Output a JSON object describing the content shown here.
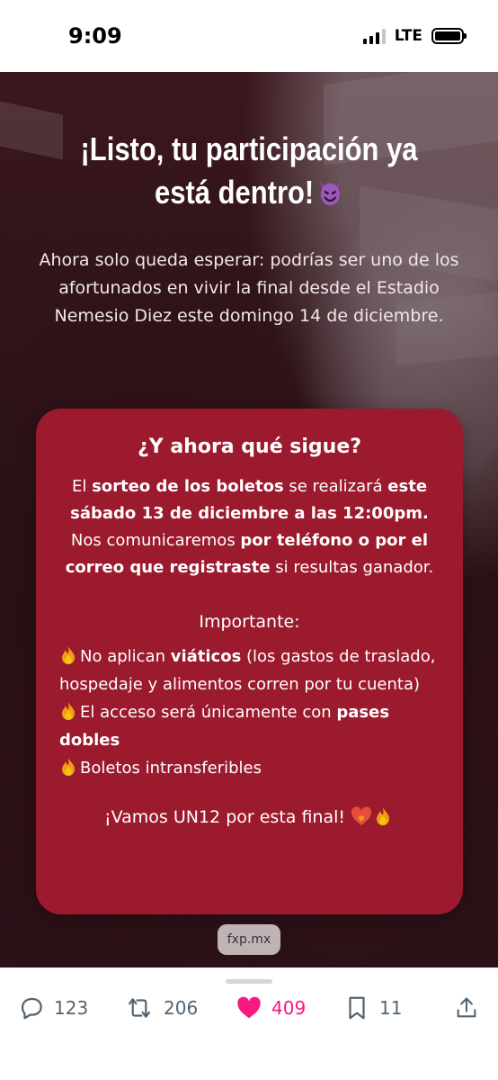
{
  "status_bar": {
    "time": "9:09",
    "network": "LTE"
  },
  "post": {
    "headline_line1": "¡Listo, tu participación ya",
    "headline_line2": "está dentro!",
    "subtext": "Ahora solo queda esperar: podrías ser uno de los afortunados en vivir la final desde el Estadio Nemesio Diez este domingo 14 de diciembre.",
    "card": {
      "title": "¿Y ahora qué sigue?",
      "p1_a": "El ",
      "p1_b": "sorteo de los boletos",
      "p1_c": " se realizará ",
      "p1_d": "este sábado 13 de diciembre a las 12:00pm.",
      "p2_a": "Nos comunicaremos ",
      "p2_b": "por teléfono o por el correo que registraste",
      "p2_c": " si resultas ganador.",
      "important": "Importante:",
      "b1_a": "No aplican ",
      "b1_b": "viáticos",
      "b1_c": " (los gastos de traslado, hospedaje y alimentos corren por tu cuenta)",
      "b2_a": "El acceso será únicamente con ",
      "b2_b": "pases dobles",
      "b3": "Boletos intransferibles",
      "closing": "¡Vamos UN12 por esta final!"
    },
    "domain": "fxp.mx"
  },
  "actions": {
    "replies": "123",
    "reposts": "206",
    "likes": "409",
    "bookmarks": "11"
  },
  "colors": {
    "card": "#9b1a2d",
    "like": "#f91880",
    "action_gray": "#536471"
  }
}
